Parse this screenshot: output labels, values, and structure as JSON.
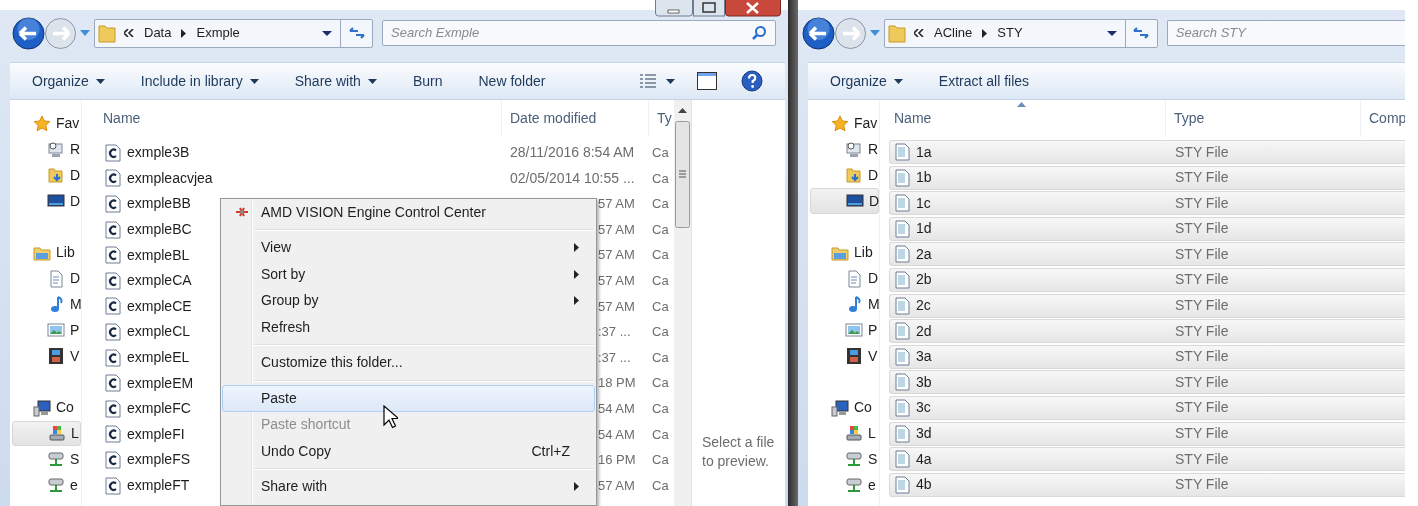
{
  "windows": [
    {
      "address": {
        "crumbs": [
          "Data",
          "Exmple"
        ]
      },
      "search": {
        "placeholder": "Search Exmple"
      },
      "toolbar": [
        {
          "label": "Organize",
          "dropdown": true
        },
        {
          "label": "Include in library",
          "dropdown": true
        },
        {
          "label": "Share with",
          "dropdown": true
        },
        {
          "label": "Burn",
          "dropdown": false
        },
        {
          "label": "New folder",
          "dropdown": false
        }
      ],
      "nav": [
        {
          "label": "Fav",
          "kind": "favorites",
          "selected": false,
          "children": [
            {
              "label": "R",
              "kind": "recent",
              "selected": false
            },
            {
              "label": "D",
              "kind": "downloads",
              "selected": false
            },
            {
              "label": "D",
              "kind": "desktop",
              "selected": false
            }
          ]
        },
        {
          "label": "Lib",
          "kind": "libraries",
          "selected": false,
          "children": [
            {
              "label": "D",
              "kind": "documents",
              "selected": false
            },
            {
              "label": "M",
              "kind": "music",
              "selected": false
            },
            {
              "label": "P",
              "kind": "pictures",
              "selected": false
            },
            {
              "label": "V",
              "kind": "videos",
              "selected": false
            }
          ]
        },
        {
          "label": "Co",
          "kind": "computer",
          "selected": false,
          "children": [
            {
              "label": "L",
              "kind": "drive",
              "selected": true
            },
            {
              "label": "S",
              "kind": "network",
              "selected": false
            },
            {
              "label": "e",
              "kind": "network",
              "selected": false
            }
          ]
        }
      ],
      "columns": [
        {
          "label": "Name",
          "sorted": false
        },
        {
          "label": "Date modified",
          "sorted": false
        },
        {
          "label": "Ty",
          "sorted": false
        }
      ],
      "rows": [
        {
          "cells": [
            "exmple3B",
            "28/11/2016 8:54 AM",
            "Ca"
          ],
          "covered": false,
          "selected": false
        },
        {
          "cells": [
            "exmpleacvjea",
            "02/05/2014 10:55 ...",
            "Ca"
          ],
          "covered": false,
          "selected": false
        },
        {
          "cells": [
            "exmpleBB",
            "57 AM",
            "Ca"
          ],
          "covered": true,
          "selected": false
        },
        {
          "cells": [
            "exmpleBC",
            "57 AM",
            "Ca"
          ],
          "covered": true,
          "selected": false
        },
        {
          "cells": [
            "exmpleBL",
            "57 AM",
            "Ca"
          ],
          "covered": true,
          "selected": false
        },
        {
          "cells": [
            "exmpleCA",
            "57 AM",
            "Ca"
          ],
          "covered": true,
          "selected": false
        },
        {
          "cells": [
            "exmpleCE",
            "57 AM",
            "Ca"
          ],
          "covered": true,
          "selected": false
        },
        {
          "cells": [
            "exmpleCL",
            ":37 ...",
            "Ca"
          ],
          "covered": true,
          "selected": false
        },
        {
          "cells": [
            "exmpleEL",
            ":37 ...",
            "Ca"
          ],
          "covered": true,
          "selected": false
        },
        {
          "cells": [
            "exmpleEM",
            "18 PM",
            "Ca"
          ],
          "covered": true,
          "selected": false
        },
        {
          "cells": [
            "exmpleFC",
            "54 AM",
            "Ca"
          ],
          "covered": true,
          "selected": false
        },
        {
          "cells": [
            "exmpleFI",
            "54 AM",
            "Ca"
          ],
          "covered": true,
          "selected": false
        },
        {
          "cells": [
            "exmpleFS",
            "16 PM",
            "Ca"
          ],
          "covered": true,
          "selected": false
        },
        {
          "cells": [
            "exmpleFT",
            "57 AM",
            "Ca"
          ],
          "covered": true,
          "selected": false
        }
      ],
      "preview_text": "Select a file to preview.",
      "context_menu": [
        {
          "kind": "app-item",
          "label": "AMD VISION Engine Control Center",
          "submenu": false,
          "disabled": false,
          "selected": false
        },
        {
          "kind": "separator"
        },
        {
          "kind": "item",
          "label": "View",
          "submenu": true,
          "disabled": false,
          "selected": false
        },
        {
          "kind": "item",
          "label": "Sort by",
          "submenu": true,
          "disabled": false,
          "selected": false
        },
        {
          "kind": "item",
          "label": "Group by",
          "submenu": true,
          "disabled": false,
          "selected": false
        },
        {
          "kind": "item",
          "label": "Refresh",
          "submenu": false,
          "disabled": false,
          "selected": false
        },
        {
          "kind": "separator"
        },
        {
          "kind": "item",
          "label": "Customize this folder...",
          "submenu": false,
          "disabled": false,
          "selected": false
        },
        {
          "kind": "separator"
        },
        {
          "kind": "item",
          "label": "Paste",
          "submenu": false,
          "disabled": false,
          "selected": true
        },
        {
          "kind": "item",
          "label": "Paste shortcut",
          "submenu": false,
          "disabled": true,
          "selected": false
        },
        {
          "kind": "item",
          "label": "Undo Copy",
          "shortcut": "Ctrl+Z",
          "submenu": false,
          "disabled": false,
          "selected": false
        },
        {
          "kind": "separator"
        },
        {
          "kind": "item",
          "label": "Share with",
          "submenu": true,
          "disabled": false,
          "selected": false
        }
      ]
    },
    {
      "address": {
        "crumbs": [
          "ACline",
          "STY"
        ]
      },
      "search": {
        "placeholder": "Search STY"
      },
      "toolbar": [
        {
          "label": "Organize",
          "dropdown": true
        },
        {
          "label": "Extract all files",
          "dropdown": false
        }
      ],
      "nav": [
        {
          "label": "Fav",
          "kind": "favorites",
          "selected": false,
          "children": [
            {
              "label": "R",
              "kind": "recent",
              "selected": false
            },
            {
              "label": "D",
              "kind": "downloads",
              "selected": false
            },
            {
              "label": "D",
              "kind": "desktop",
              "selected": true
            }
          ]
        },
        {
          "label": "Lib",
          "kind": "libraries",
          "selected": false,
          "children": [
            {
              "label": "D",
              "kind": "documents",
              "selected": false
            },
            {
              "label": "M",
              "kind": "music",
              "selected": false
            },
            {
              "label": "P",
              "kind": "pictures",
              "selected": false
            },
            {
              "label": "V",
              "kind": "videos",
              "selected": false
            }
          ]
        },
        {
          "label": "Co",
          "kind": "computer",
          "selected": false,
          "children": [
            {
              "label": "L",
              "kind": "drive",
              "selected": false
            },
            {
              "label": "S",
              "kind": "network",
              "selected": false
            },
            {
              "label": "e",
              "kind": "network",
              "selected": false
            }
          ]
        }
      ],
      "columns": [
        {
          "label": "Name",
          "sorted": true
        },
        {
          "label": "Type",
          "sorted": false
        },
        {
          "label": "Comp",
          "sorted": false
        }
      ],
      "rows": [
        {
          "cells": [
            "1a",
            "STY File"
          ],
          "selected": true
        },
        {
          "cells": [
            "1b",
            "STY File"
          ],
          "selected": true
        },
        {
          "cells": [
            "1c",
            "STY File"
          ],
          "selected": true
        },
        {
          "cells": [
            "1d",
            "STY File"
          ],
          "selected": true
        },
        {
          "cells": [
            "2a",
            "STY File"
          ],
          "selected": true
        },
        {
          "cells": [
            "2b",
            "STY File"
          ],
          "selected": true
        },
        {
          "cells": [
            "2c",
            "STY File"
          ],
          "selected": true
        },
        {
          "cells": [
            "2d",
            "STY File"
          ],
          "selected": true
        },
        {
          "cells": [
            "3a",
            "STY File"
          ],
          "selected": true
        },
        {
          "cells": [
            "3b",
            "STY File"
          ],
          "selected": true
        },
        {
          "cells": [
            "3c",
            "STY File"
          ],
          "selected": true
        },
        {
          "cells": [
            "3d",
            "STY File"
          ],
          "selected": true
        },
        {
          "cells": [
            "4a",
            "STY File"
          ],
          "selected": true
        },
        {
          "cells": [
            "4b",
            "STY File"
          ],
          "selected": true
        }
      ]
    }
  ]
}
